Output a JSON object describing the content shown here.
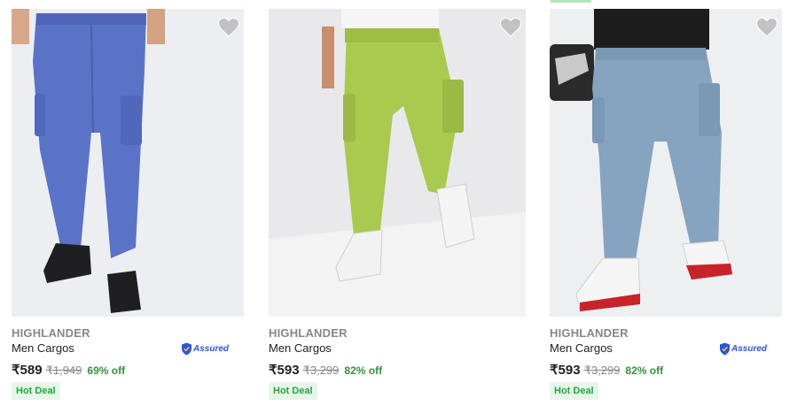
{
  "products": [
    {
      "brand": "HIGHLANDER",
      "title": "Men Cargos",
      "price": "₹589",
      "mrp": "₹1,949",
      "discount": "69% off",
      "deal": "Hot Deal",
      "assured": "Assured",
      "pant_color": "#5b73c7",
      "icon": "heart-icon"
    },
    {
      "brand": "HIGHLANDER",
      "title": "Men Cargos",
      "price": "₹593",
      "mrp": "₹3,299",
      "discount": "82% off",
      "deal": "Hot Deal",
      "pant_color": "#a9c94f",
      "icon": "heart-icon"
    },
    {
      "brand": "HIGHLANDER",
      "title": "Men Cargos",
      "price": "₹593",
      "mrp": "₹3,299",
      "discount": "82% off",
      "deal": "Hot Deal",
      "assured": "Assured",
      "pant_color": "#86a3bf",
      "icon": "heart-icon"
    }
  ],
  "colors": {
    "discount_green": "#388e3c",
    "deal_bg": "#e7f6ea",
    "deal_text": "#26a541",
    "assured_blue": "#2a55e5",
    "wishlist_grey": "#c2c2c2"
  }
}
